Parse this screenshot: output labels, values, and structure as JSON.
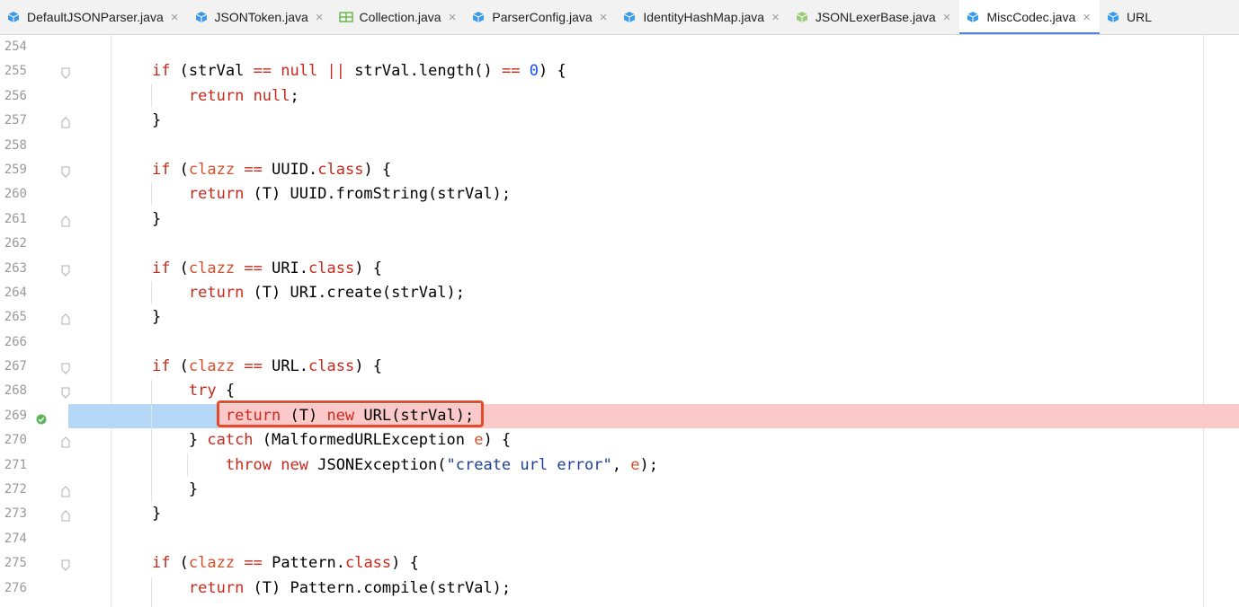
{
  "tabs": [
    {
      "label": "DefaultJSONParser.java",
      "icon": "java-class-icon",
      "active": false
    },
    {
      "label": "JSONToken.java",
      "icon": "java-class-icon",
      "active": false
    },
    {
      "label": "Collection.java",
      "icon": "java-interface-icon",
      "active": false
    },
    {
      "label": "ParserConfig.java",
      "icon": "java-class-icon",
      "active": false
    },
    {
      "label": "IdentityHashMap.java",
      "icon": "java-class-icon",
      "active": false
    },
    {
      "label": "JSONLexerBase.java",
      "icon": "java-abstract-class-icon",
      "active": false
    },
    {
      "label": "MiscCodec.java",
      "icon": "java-class-icon",
      "active": true
    },
    {
      "label": "URL",
      "icon": "java-class-icon",
      "active": false
    }
  ],
  "tab_close_glyph": "×",
  "editor": {
    "breakpoint_line": "269",
    "lines": [
      {
        "no": "254",
        "code": ""
      },
      {
        "no": "255",
        "code": "if (strVal == null || strVal.length() == 0) {"
      },
      {
        "no": "256",
        "code": "    return null;"
      },
      {
        "no": "257",
        "code": "}"
      },
      {
        "no": "258",
        "code": ""
      },
      {
        "no": "259",
        "code": "if (clazz == UUID.class) {"
      },
      {
        "no": "260",
        "code": "    return (T) UUID.fromString(strVal);"
      },
      {
        "no": "261",
        "code": "}"
      },
      {
        "no": "262",
        "code": ""
      },
      {
        "no": "263",
        "code": "if (clazz == URI.class) {"
      },
      {
        "no": "264",
        "code": "    return (T) URI.create(strVal);"
      },
      {
        "no": "265",
        "code": "}"
      },
      {
        "no": "266",
        "code": ""
      },
      {
        "no": "267",
        "code": "if (clazz == URL.class) {"
      },
      {
        "no": "268",
        "code": "    try {"
      },
      {
        "no": "269",
        "code": "        return (T) new URL(strVal);"
      },
      {
        "no": "270",
        "code": "    } catch (MalformedURLException e) {"
      },
      {
        "no": "271",
        "code": "        throw new JSONException(\"create url error\", e);"
      },
      {
        "no": "272",
        "code": "    }"
      },
      {
        "no": "273",
        "code": "}"
      },
      {
        "no": "274",
        "code": ""
      },
      {
        "no": "275",
        "code": "if (clazz == Pattern.class) {"
      },
      {
        "no": "276",
        "code": "    return (T) Pattern.compile(strVal);"
      }
    ]
  },
  "colors": {
    "keyword": "#c7291b",
    "number": "#1a4cff",
    "string": "#1c3f9a",
    "variable": "#d4502a",
    "execution_line": "#fbc9c9",
    "selection": "#b3d7f5",
    "annotation_box": "#e34b2c",
    "active_tab_underline": "#4a86e8"
  }
}
